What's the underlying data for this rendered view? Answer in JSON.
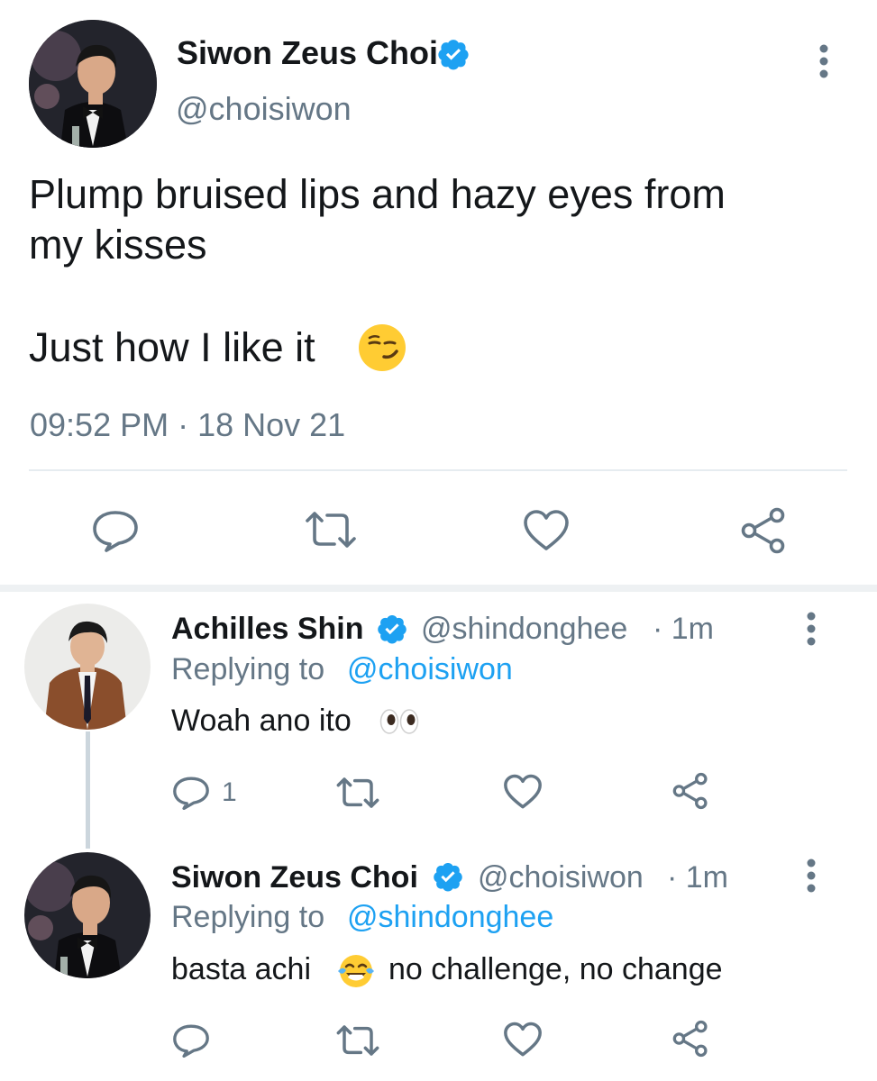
{
  "main_tweet": {
    "author_name": "Siwon Zeus Choi",
    "handle": "@choisiwon",
    "text_line1": "Plump bruised lips and hazy eyes from",
    "text_line2": "my kisses",
    "text_line3": "Just how I like it",
    "emoji": "smirking-face",
    "timestamp": "09:52 PM · 18 Nov 21",
    "actions": [
      "reply-icon",
      "retweet-icon",
      "like-icon",
      "share-icon"
    ]
  },
  "replies": [
    {
      "author_name": "Achilles Shin",
      "handle": "@shindonghee",
      "time": "· 1m",
      "replying_prefix": "Replying to",
      "replying_to": "@choisiwon",
      "text": "Woah ano ito",
      "emoji": "eyes",
      "reply_count": "1"
    },
    {
      "author_name": "Siwon Zeus Choi",
      "handle": "@choisiwon",
      "time": "· 1m",
      "replying_prefix": "Replying to",
      "replying_to": "@shindonghee",
      "text_before_emoji": "basta achi",
      "emoji": "face-with-tears-of-joy",
      "text_after_emoji": "no challenge, no change"
    }
  ],
  "colors": {
    "verified": "#1da1f2",
    "link": "#1da1f2",
    "secondary_text": "#657786",
    "icon": "#657786",
    "divider": "#e6ecf0"
  }
}
